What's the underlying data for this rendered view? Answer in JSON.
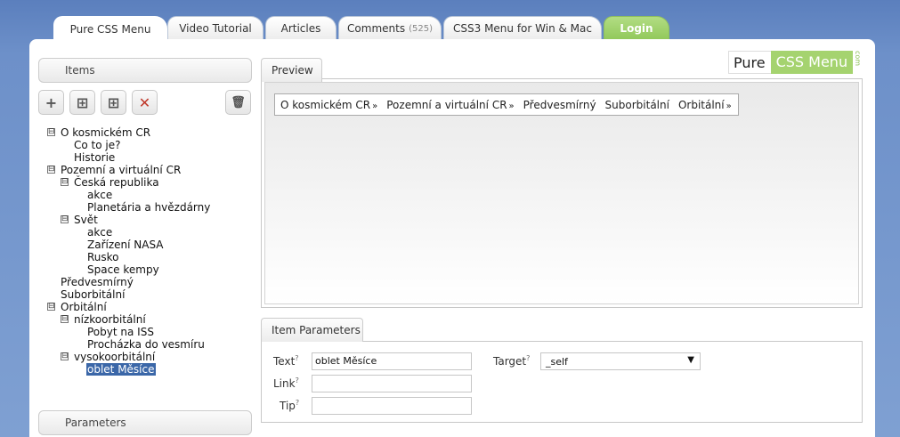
{
  "top_tabs": [
    {
      "label": "Pure CSS Menu"
    },
    {
      "label": "Video Tutorial"
    },
    {
      "label": "Articles"
    },
    {
      "label": "Comments",
      "count": "(525)"
    },
    {
      "label": "CSS3 Menu for Win & Mac"
    },
    {
      "label": "Login"
    }
  ],
  "sidebar": {
    "items_header": "Items",
    "parameters_header": "Parameters",
    "toolbar": [
      {
        "icon": "plus-icon",
        "glyph": "+"
      },
      {
        "icon": "add-subitem-icon",
        "glyph": "⊞"
      },
      {
        "icon": "add-item-below-icon",
        "glyph": "⊞"
      },
      {
        "icon": "delete-icon",
        "glyph": "✕"
      },
      {
        "icon": "trash-icon",
        "glyph": "🗑"
      }
    ],
    "tree": [
      {
        "label": "O kosmickém CR",
        "toggle": "⊟"
      },
      {
        "label": "Co to je?"
      },
      {
        "label": "Historie"
      },
      {
        "label": "Pozemní a virtuální CR",
        "toggle": "⊟"
      },
      {
        "label": "Česká republika",
        "toggle": "⊟"
      },
      {
        "label": "akce"
      },
      {
        "label": "Planetária a hvězdárny"
      },
      {
        "label": "Svět",
        "toggle": "⊟"
      },
      {
        "label": "akce"
      },
      {
        "label": "Zařízení NASA"
      },
      {
        "label": "Rusko"
      },
      {
        "label": "Space kempy"
      },
      {
        "label": "Předvesmírný"
      },
      {
        "label": "Suborbitální"
      },
      {
        "label": "Orbitální",
        "toggle": "⊟"
      },
      {
        "label": "nízkoorbitální",
        "toggle": "⊟"
      },
      {
        "label": "Pobyt na ISS"
      },
      {
        "label": "Procházka do vesmíru"
      },
      {
        "label": "vysokoorbitální",
        "toggle": "⊟"
      },
      {
        "label": "oblet Měsíce",
        "selected": true
      }
    ]
  },
  "logo": {
    "pure": "Pure",
    "css": "CSS Menu",
    "com": "com"
  },
  "preview": {
    "tab_label": "Preview",
    "menu": [
      {
        "label": "O kosmickém CR",
        "arrow": "»"
      },
      {
        "label": "Pozemní a virtuální CR",
        "arrow": "»"
      },
      {
        "label": "Předvesmírný",
        "arrow": ""
      },
      {
        "label": "Suborbitální",
        "arrow": ""
      },
      {
        "label": "Orbitální",
        "arrow": "»"
      }
    ]
  },
  "item_parameters": {
    "tab_label": "Item Parameters",
    "text_label": "Text",
    "text_value": "oblet Měsíce",
    "link_label": "Link",
    "link_value": "",
    "tip_label": "Tip",
    "tip_value": "",
    "target_label": "Target",
    "target_value": "_self",
    "help_mark": "?"
  }
}
